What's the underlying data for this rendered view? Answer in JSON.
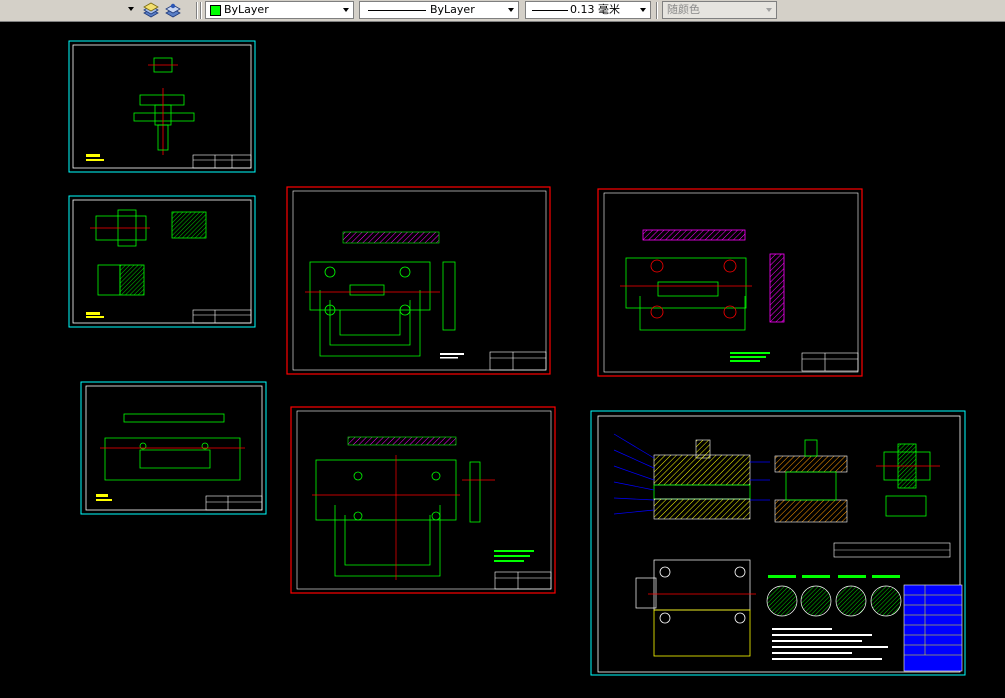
{
  "toolbar": {
    "color_combo": {
      "value": "ByLayer",
      "swatch_color": "#00ff00"
    },
    "linetype_combo": {
      "value": "ByLayer"
    },
    "lineweight_combo": {
      "value": "0.13 毫米"
    },
    "plotstyle_combo": {
      "value": "随颜色"
    }
  },
  "colors": {
    "background": "#000000",
    "sheet_border_cyan": "#00ffff",
    "sheet_border_red": "#ff0000",
    "geometry_green": "#00ff00",
    "centerline_red": "#ff0000",
    "hatch_magenta": "#ff00ff",
    "annotation_yellow": "#ffff00",
    "leader_blue": "#0000ff",
    "white": "#ffffff"
  }
}
